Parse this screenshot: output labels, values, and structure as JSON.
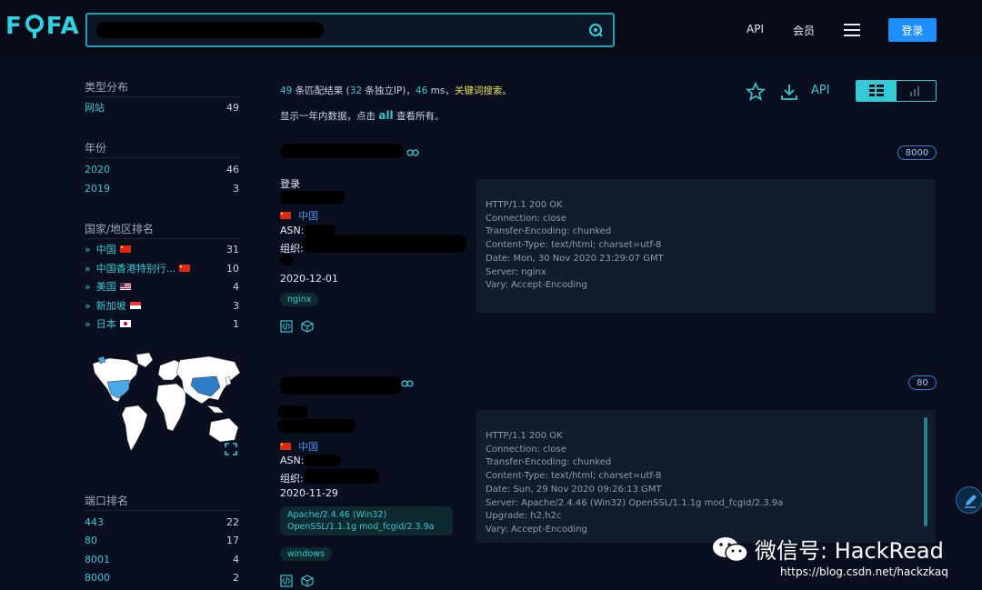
{
  "header": {
    "logo_left": "F",
    "logo_right": "FA",
    "search": {
      "placeholder": ""
    },
    "nav": {
      "api": "API",
      "member": "会员",
      "login": "登录"
    }
  },
  "sidebar": {
    "type": {
      "title": "类型分布",
      "items": [
        {
          "label": "网站",
          "count": "49"
        }
      ]
    },
    "year": {
      "title": "年份",
      "items": [
        {
          "label": "2020",
          "count": "46"
        },
        {
          "label": "2019",
          "count": "3"
        }
      ]
    },
    "country": {
      "title": "国家/地区排名",
      "items": [
        {
          "label": "中国",
          "count": "31"
        },
        {
          "label": "中国香港特别行...",
          "count": "10"
        },
        {
          "label": "美国",
          "count": "4"
        },
        {
          "label": "新加坡",
          "count": "3"
        },
        {
          "label": "日本",
          "count": "1"
        }
      ]
    },
    "port": {
      "title": "端口排名",
      "items": [
        {
          "label": "443",
          "count": "22"
        },
        {
          "label": "80",
          "count": "17"
        },
        {
          "label": "8001",
          "count": "4"
        },
        {
          "label": "8000",
          "count": "2"
        }
      ]
    }
  },
  "stats": {
    "results": "49",
    "results_suffix": " 条匹配结果 (",
    "unique_ip": "32",
    "ip_suffix": " 条独立IP)，",
    "ms": "46",
    "ms_suffix": " ms，",
    "keyword": "关键词搜索。",
    "sub_prefix": "显示一年内数据，点击 ",
    "sub_all": "all",
    "sub_suffix": " 查看所有。"
  },
  "toolbar": {
    "api": "API"
  },
  "results": [
    {
      "port": "8000",
      "title": "登录",
      "country": "中国",
      "asn_label": "ASN:",
      "org_label": "组织:",
      "date": "2020-12-01",
      "tags": [
        "nginx"
      ],
      "headers": [
        "HTTP/1.1 200 OK",
        "Connection: close",
        "Transfer-Encoding: chunked",
        "Content-Type: text/html; charset=utf-8",
        "Date: Mon, 30 Nov 2020 23:29:07 GMT",
        "Server: nginx",
        "Vary: Accept-Encoding"
      ]
    },
    {
      "port": "80",
      "country": "中国",
      "asn_label": "ASN:",
      "org_label": "组织:",
      "date": "2020-11-29",
      "tags": [
        "Apache/2.4.46 (Win32) OpenSSL/1.1.1g mod_fcgid/2.3.9a",
        "windows"
      ],
      "headers": [
        "HTTP/1.1 200 OK",
        "Connection: close",
        "Transfer-Encoding: chunked",
        "Content-Type: text/html; charset=utf-8",
        "Date: Sun, 29 Nov 2020 09:26:13 GMT",
        "Server: Apache/2.4.46 (Win32) OpenSSL/1.1.1g mod_fcgid/2.3.9a",
        "Upgrade: h2,h2c",
        "Vary: Accept-Encoding"
      ]
    }
  ],
  "watermark": {
    "text": "微信号: HackRead",
    "url": "https://blog.csdn.net/hackzkaq"
  },
  "colors": {
    "accent": "#35c9d6",
    "background": "#0a0f1f",
    "login": "#1e8fff",
    "keyword": "#e8e05a"
  }
}
